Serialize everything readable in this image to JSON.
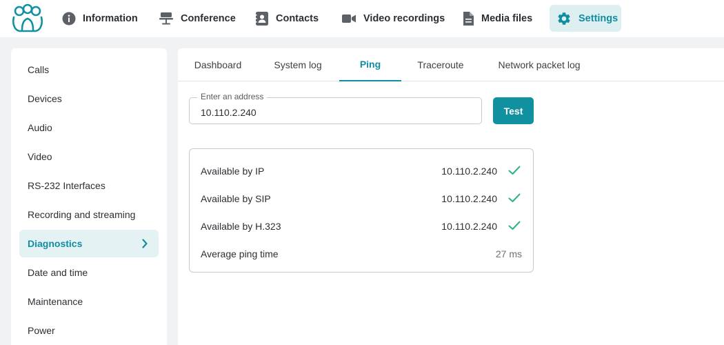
{
  "colors": {
    "accent": "#0f8ea0",
    "accent_bg": "#ddeff1",
    "check": "#2bb08a"
  },
  "nav": {
    "logo_icon": "people-logo-icon",
    "items": [
      {
        "label": "Information",
        "icon": "info-circle-icon"
      },
      {
        "label": "Conference",
        "icon": "conference-icon"
      },
      {
        "label": "Contacts",
        "icon": "contacts-icon"
      },
      {
        "label": "Video recordings",
        "icon": "video-camera-icon"
      },
      {
        "label": "Media files",
        "icon": "document-icon"
      },
      {
        "label": "Settings",
        "icon": "gear-icon",
        "active": true
      }
    ]
  },
  "sidebar": {
    "items": [
      {
        "label": "Calls"
      },
      {
        "label": "Devices"
      },
      {
        "label": "Audio"
      },
      {
        "label": "Video"
      },
      {
        "label": "RS-232 Interfaces"
      },
      {
        "label": "Recording and streaming"
      },
      {
        "label": "Diagnostics",
        "active": true
      },
      {
        "label": "Date and time"
      },
      {
        "label": "Maintenance"
      },
      {
        "label": "Power"
      }
    ]
  },
  "tabs": [
    {
      "label": "Dashboard"
    },
    {
      "label": "System log"
    },
    {
      "label": "Ping",
      "active": true
    },
    {
      "label": "Traceroute"
    },
    {
      "label": "Network packet log"
    }
  ],
  "ping": {
    "address_label": "Enter an address",
    "address_value": "10.110.2.240",
    "test_label": "Test",
    "results": [
      {
        "label": "Available by IP",
        "value": "10.110.2.240",
        "status": "check-icon"
      },
      {
        "label": "Available by SIP",
        "value": "10.110.2.240",
        "status": "check-icon"
      },
      {
        "label": "Available by H.323",
        "value": "10.110.2.240",
        "status": "check-icon"
      },
      {
        "label": "Average ping time",
        "value": "27 ms"
      }
    ]
  }
}
